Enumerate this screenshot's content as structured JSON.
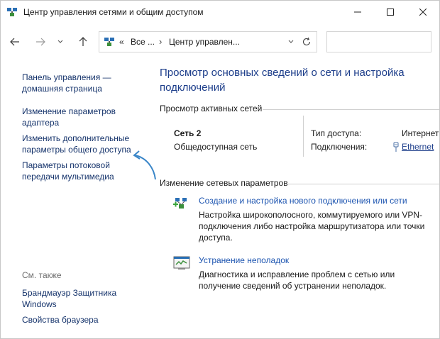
{
  "window": {
    "title": "Центр управления сетями и общим доступом"
  },
  "address": {
    "overflow": "«",
    "segment1": "Все ...",
    "separator": "›",
    "segment2": "Центр управлен...",
    "search_placeholder": ""
  },
  "sidebar": {
    "home_link": "Панель управления — домашняя страница",
    "links": [
      "Изменение параметров адаптера",
      "Изменить дополнительные параметры общего доступа",
      "Параметры потоковой передачи мультимедиа"
    ],
    "see_also_label": "См. также",
    "see_also": [
      "Брандмауэр Защитника Windows",
      "Свойства браузера"
    ]
  },
  "main": {
    "title": "Просмотр основных сведений о сети и настройка подключений",
    "active_networks_header": "Просмотр активных сетей",
    "network": {
      "name": "Сеть 2",
      "type": "Общедоступная сеть",
      "access_type_label": "Тип доступа:",
      "access_type_value": "Интернет",
      "connections_label": "Подключения:",
      "connections_value": "Ethernet"
    },
    "change_header": "Изменение сетевых параметров",
    "tasks": [
      {
        "link": "Создание и настройка нового подключения или сети",
        "desc": "Настройка широкополосного, коммутируемого или VPN-подключения либо настройка маршрутизатора или точки доступа."
      },
      {
        "link": "Устранение неполадок",
        "desc": "Диагностика и исправление проблем с сетью или получение сведений об устранении неполадок."
      }
    ]
  },
  "icons": {
    "app": "network-center-icon",
    "back": "arrow-left-icon",
    "forward": "arrow-right-icon",
    "up": "arrow-up-icon",
    "refresh": "refresh-icon",
    "annotation": "curved-arrow-icon"
  },
  "colors": {
    "link": "#1c54b0",
    "title": "#1c3d8a",
    "annotation_arrow": "#3a86c8"
  }
}
